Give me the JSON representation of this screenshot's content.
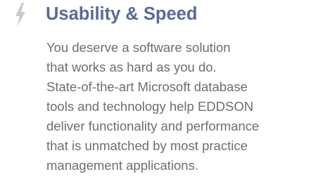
{
  "feature": {
    "icon": "lightning-bolt-icon",
    "title": "Usability & Speed",
    "description_lines": [
      "You deserve a software solution",
      "that works as hard as you do.",
      "State-of-the-art Microsoft database",
      "tools and technology help EDDSON",
      "deliver functionality and performance",
      "that is unmatched by most practice",
      "management applications."
    ]
  },
  "colors": {
    "title": "#5b6a94",
    "body": "#6e6e6e",
    "icon": "#c9c9c9"
  }
}
